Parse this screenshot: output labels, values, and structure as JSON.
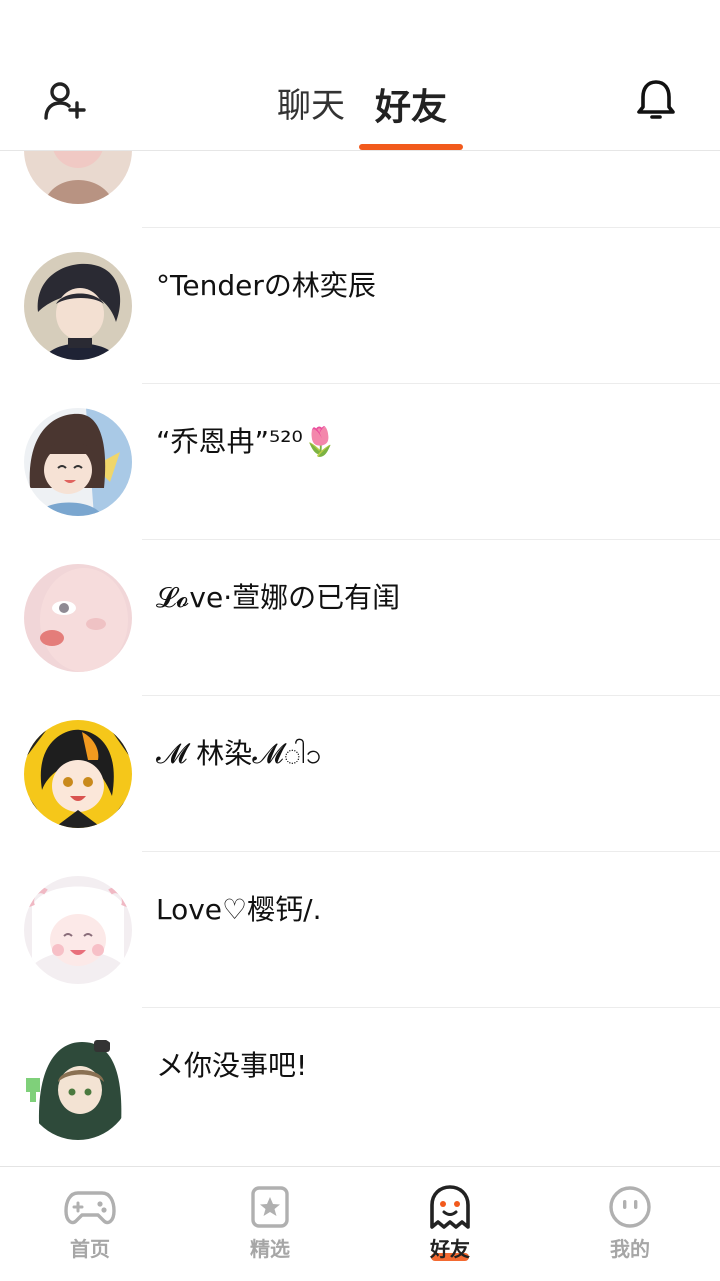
{
  "header": {
    "tabs": [
      {
        "label": "聊天",
        "active": false
      },
      {
        "label": "好友",
        "active": true
      }
    ],
    "accent_color": "#f25a1c",
    "left_icon": "add-friend-icon",
    "right_icon": "bell-icon"
  },
  "friends": [
    {
      "name": "",
      "avatar": "avatar-1"
    },
    {
      "name": "°Tenderの林奕辰",
      "avatar": "avatar-2"
    },
    {
      "name": "“乔恩冉”⁵²⁰🌷",
      "avatar": "avatar-3"
    },
    {
      "name": "𝓛𝓸ve·萱娜の已有闺",
      "avatar": "avatar-4"
    },
    {
      "name": "𝓜    林染𝓜ါၥ",
      "avatar": "avatar-5"
    },
    {
      "name": "Love♡樱钙/.",
      "avatar": "avatar-6"
    },
    {
      "name": "メ你没事吧!",
      "avatar": "avatar-7"
    }
  ],
  "bottom_nav": [
    {
      "label": "首页",
      "icon": "gamepad-icon",
      "active": false
    },
    {
      "label": "精选",
      "icon": "star-card-icon",
      "active": false
    },
    {
      "label": "好友",
      "icon": "ghost-icon",
      "active": true
    },
    {
      "label": "我的",
      "icon": "face-icon",
      "active": false
    }
  ]
}
